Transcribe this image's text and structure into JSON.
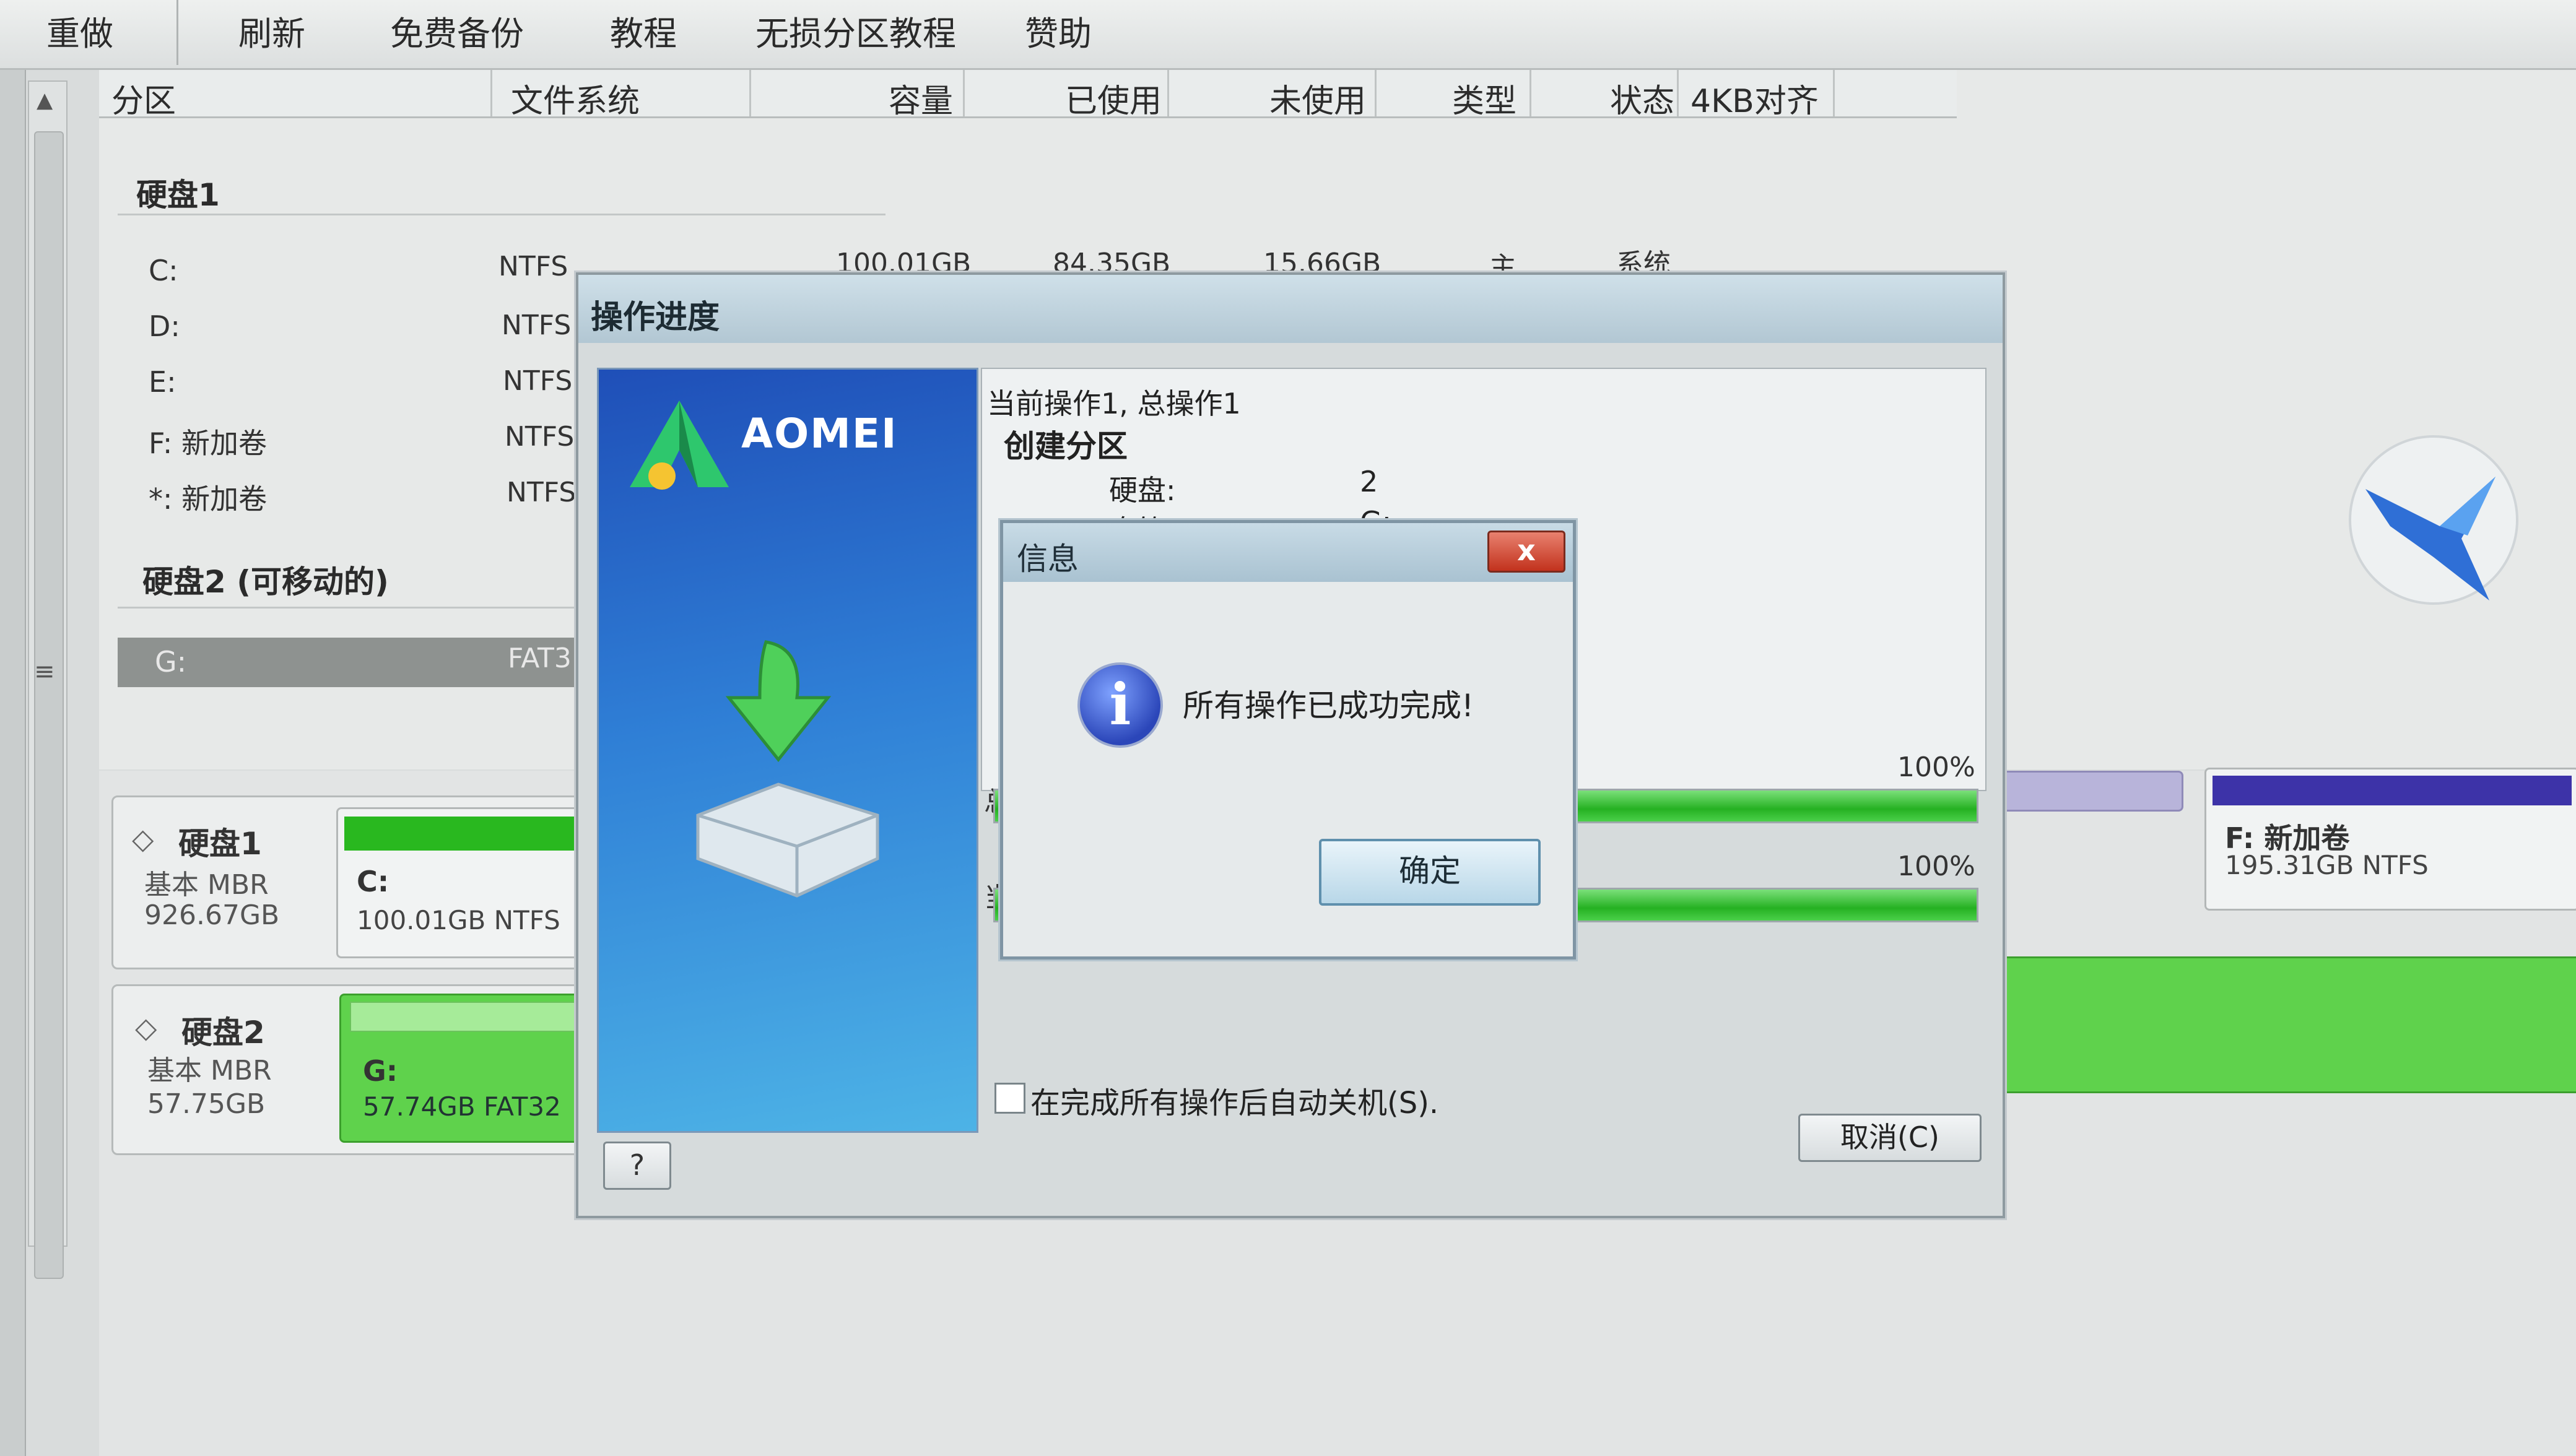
{
  "toolbar": {
    "items": [
      "重做",
      "刷新",
      "免费备份",
      "教程",
      "无损分区教程",
      "赞助"
    ]
  },
  "columns": [
    "分区",
    "文件系统",
    "容量",
    "已使用",
    "未使用",
    "类型",
    "状态",
    "4KB对齐"
  ],
  "disk1_group": {
    "title": "硬盘1",
    "rows": [
      {
        "name": "C:",
        "fs": "NTFS",
        "capacity": "100.01GB",
        "used": "84.35GB",
        "free": "15.66GB",
        "type": "主",
        "status": "系统"
      },
      {
        "name": "D:",
        "fs": "NTFS"
      },
      {
        "name": "E:",
        "fs": "NTFS"
      },
      {
        "name": "F: 新加卷",
        "fs": "NTFS"
      },
      {
        "name": "*: 新加卷",
        "fs": "NTFS"
      }
    ]
  },
  "disk2_group": {
    "title": "硬盘2 (可移动的)",
    "rows": [
      {
        "name": "G:",
        "fs": "FAT3"
      }
    ]
  },
  "diskmap": {
    "disk1": {
      "title": "硬盘1",
      "type": "基本 MBR",
      "size": "926.67GB",
      "part_name": "C:",
      "part_info": "100.01GB NTFS"
    },
    "disk2": {
      "title": "硬盘2",
      "type": "基本 MBR",
      "size": "57.75GB",
      "part_name": "G:",
      "part_info": "57.74GB FAT32"
    },
    "f_part": {
      "name": "F: 新加卷",
      "info": "195.31GB NTFS"
    }
  },
  "progress_dialog": {
    "title": "操作进度",
    "brand": "AOMEI",
    "current_line": "当前操作1, 总操作1",
    "operation": "创建分区",
    "disk_label": "硬盘:",
    "disk_value": "2",
    "drive_label": "盘符:",
    "drive_value": "G:",
    "bar1_label": "总",
    "bar1_percent": "100%",
    "bar1_fraction": 1.0,
    "bar2_label": "当",
    "bar2_percent": "100%",
    "bar2_fraction": 1.0,
    "shutdown_label": "在完成所有操作后自动关机(S).",
    "cancel_label": "取消(C)",
    "help_label": "?"
  },
  "message_box": {
    "title": "信息",
    "close_label": "x",
    "icon_glyph": "i",
    "text": "所有操作已成功完成!",
    "ok_label": "确定"
  },
  "colors": {
    "accent_blue": "#2f7fd6",
    "progress_green": "#25b122",
    "close_red": "#c2321d"
  }
}
